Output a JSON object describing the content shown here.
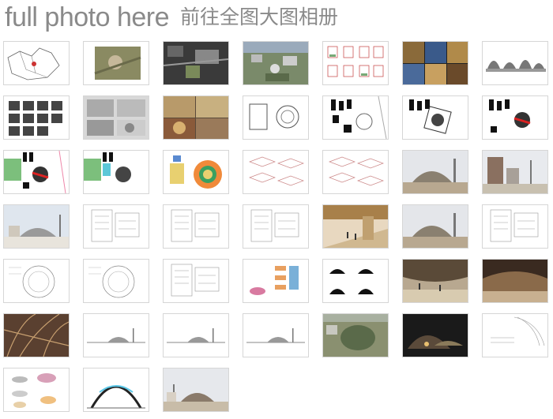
{
  "header": {
    "title_en": "full photo here",
    "title_cn": "前往全图大图相册"
  },
  "thumbnails": [
    {
      "kind": "map"
    },
    {
      "kind": "aerial"
    },
    {
      "kind": "darkphoto"
    },
    {
      "kind": "city"
    },
    {
      "kind": "plans"
    },
    {
      "kind": "collage"
    },
    {
      "kind": "domes"
    },
    {
      "kind": "bwgrid"
    },
    {
      "kind": "models"
    },
    {
      "kind": "interior"
    },
    {
      "kind": "plancircle"
    },
    {
      "kind": "blocks"
    },
    {
      "kind": "blocksplan"
    },
    {
      "kind": "blocksred"
    },
    {
      "kind": "greenplan"
    },
    {
      "kind": "greencyan"
    },
    {
      "kind": "orange"
    },
    {
      "kind": "axo"
    },
    {
      "kind": "axo"
    },
    {
      "kind": "domeexterior"
    },
    {
      "kind": "building"
    },
    {
      "kind": "render"
    },
    {
      "kind": "lineplan"
    },
    {
      "kind": "lineplan"
    },
    {
      "kind": "lineplan"
    },
    {
      "kind": "brown"
    },
    {
      "kind": "domeexterior"
    },
    {
      "kind": "lineplan"
    },
    {
      "kind": "circleplan"
    },
    {
      "kind": "circleplan"
    },
    {
      "kind": "lineplan"
    },
    {
      "kind": "diagram"
    },
    {
      "kind": "domes-bw"
    },
    {
      "kind": "canopy"
    },
    {
      "kind": "canopydark"
    },
    {
      "kind": "forest"
    },
    {
      "kind": "elevation"
    },
    {
      "kind": "elevation"
    },
    {
      "kind": "elevation"
    },
    {
      "kind": "aerialdome"
    },
    {
      "kind": "night"
    },
    {
      "kind": "lineplan2"
    },
    {
      "kind": "bubbles"
    },
    {
      "kind": "section"
    },
    {
      "kind": "domephoto"
    }
  ]
}
